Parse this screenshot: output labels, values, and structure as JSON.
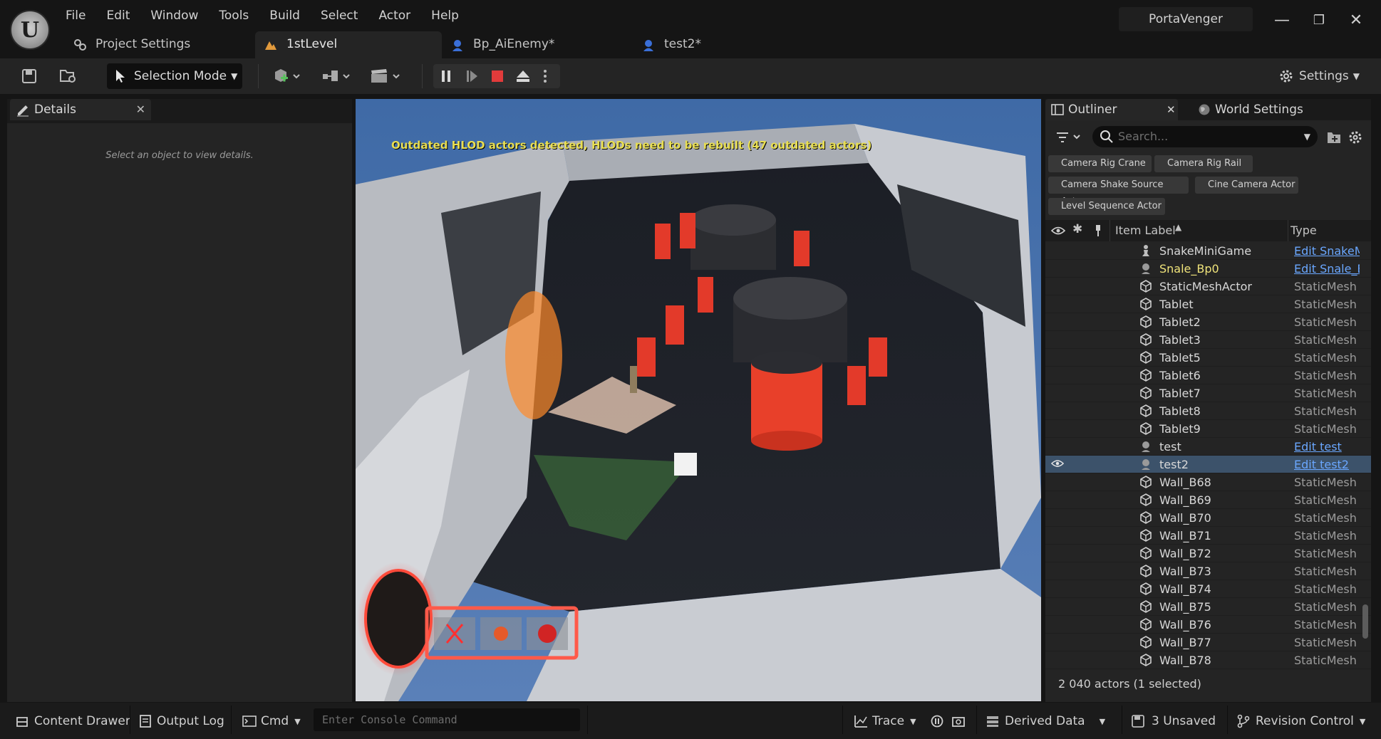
{
  "app": {
    "logo_glyph": "U",
    "menu": [
      "File",
      "Edit",
      "Window",
      "Tools",
      "Build",
      "Select",
      "Actor",
      "Help"
    ],
    "tabs": [
      {
        "label": "Project Settings",
        "icon": "gear-cluster-icon",
        "active": false
      },
      {
        "label": "1stLevel",
        "icon": "level-icon",
        "active": true
      },
      {
        "label": "Bp_AiEnemy*",
        "icon": "blueprint-icon",
        "active": false
      },
      {
        "label": "test2*",
        "icon": "blueprint-icon",
        "active": false
      }
    ],
    "profile": "PortaVenger"
  },
  "toolbar": {
    "mode_label": "Selection Mode",
    "settings_label": "Settings"
  },
  "details": {
    "tab_label": "Details",
    "hint": "Select an object to view details."
  },
  "viewport": {
    "message": "Outdated HLOD actors detected, HLODs need to be rebuilt (47 outdated actors)"
  },
  "outliner": {
    "tab_label": "Outliner",
    "world_settings_label": "World Settings",
    "search_placeholder": "Search...",
    "chips": [
      "Camera Rig Crane",
      "Camera Rig Rail",
      "Camera Shake Source Actor",
      "Cine Camera Actor",
      "Level Sequence Actor"
    ],
    "columns": {
      "label": "Item Label",
      "type": "Type"
    },
    "rows": [
      {
        "label": "SnakeMiniGame",
        "type": "Edit SnakeM",
        "link": true,
        "icon": "pawn-icon",
        "selected": false,
        "highlight": false
      },
      {
        "label": "Snale_Bp0",
        "type": "Edit Snale_B",
        "link": true,
        "icon": "blueprint-actor-icon",
        "selected": false,
        "highlight": true
      },
      {
        "label": "StaticMeshActor",
        "type": "StaticMesh",
        "link": false,
        "icon": "static-mesh-icon",
        "selected": false,
        "highlight": false
      },
      {
        "label": "Tablet",
        "type": "StaticMesh",
        "link": false,
        "icon": "static-mesh-icon",
        "selected": false,
        "highlight": false
      },
      {
        "label": "Tablet2",
        "type": "StaticMesh",
        "link": false,
        "icon": "static-mesh-icon",
        "selected": false,
        "highlight": false
      },
      {
        "label": "Tablet3",
        "type": "StaticMesh",
        "link": false,
        "icon": "static-mesh-icon",
        "selected": false,
        "highlight": false
      },
      {
        "label": "Tablet5",
        "type": "StaticMesh",
        "link": false,
        "icon": "static-mesh-icon",
        "selected": false,
        "highlight": false
      },
      {
        "label": "Tablet6",
        "type": "StaticMesh",
        "link": false,
        "icon": "static-mesh-icon",
        "selected": false,
        "highlight": false
      },
      {
        "label": "Tablet7",
        "type": "StaticMesh",
        "link": false,
        "icon": "static-mesh-icon",
        "selected": false,
        "highlight": false
      },
      {
        "label": "Tablet8",
        "type": "StaticMesh",
        "link": false,
        "icon": "static-mesh-icon",
        "selected": false,
        "highlight": false
      },
      {
        "label": "Tablet9",
        "type": "StaticMesh",
        "link": false,
        "icon": "static-mesh-icon",
        "selected": false,
        "highlight": false
      },
      {
        "label": "test",
        "type": "Edit test",
        "link": true,
        "icon": "blueprint-actor-icon",
        "selected": false,
        "highlight": false
      },
      {
        "label": "test2",
        "type": "Edit test2",
        "link": true,
        "icon": "blueprint-actor-icon",
        "selected": true,
        "highlight": false
      },
      {
        "label": "Wall_B68",
        "type": "StaticMesh",
        "link": false,
        "icon": "static-mesh-icon",
        "selected": false,
        "highlight": false
      },
      {
        "label": "Wall_B69",
        "type": "StaticMesh",
        "link": false,
        "icon": "static-mesh-icon",
        "selected": false,
        "highlight": false
      },
      {
        "label": "Wall_B70",
        "type": "StaticMesh",
        "link": false,
        "icon": "static-mesh-icon",
        "selected": false,
        "highlight": false
      },
      {
        "label": "Wall_B71",
        "type": "StaticMesh",
        "link": false,
        "icon": "static-mesh-icon",
        "selected": false,
        "highlight": false
      },
      {
        "label": "Wall_B72",
        "type": "StaticMesh",
        "link": false,
        "icon": "static-mesh-icon",
        "selected": false,
        "highlight": false
      },
      {
        "label": "Wall_B73",
        "type": "StaticMesh",
        "link": false,
        "icon": "static-mesh-icon",
        "selected": false,
        "highlight": false
      },
      {
        "label": "Wall_B74",
        "type": "StaticMesh",
        "link": false,
        "icon": "static-mesh-icon",
        "selected": false,
        "highlight": false
      },
      {
        "label": "Wall_B75",
        "type": "StaticMesh",
        "link": false,
        "icon": "static-mesh-icon",
        "selected": false,
        "highlight": false
      },
      {
        "label": "Wall_B76",
        "type": "StaticMesh",
        "link": false,
        "icon": "static-mesh-icon",
        "selected": false,
        "highlight": false
      },
      {
        "label": "Wall_B77",
        "type": "StaticMesh",
        "link": false,
        "icon": "static-mesh-icon",
        "selected": false,
        "highlight": false
      },
      {
        "label": "Wall_B78",
        "type": "StaticMesh",
        "link": false,
        "icon": "static-mesh-icon",
        "selected": false,
        "highlight": false
      }
    ],
    "actor_count": "2 040 actors (1 selected)"
  },
  "statusbar": {
    "content_drawer": "Content Drawer",
    "output_log": "Output Log",
    "cmd": "Cmd",
    "console_placeholder": "Enter Console Command",
    "trace": "Trace",
    "derived_data": "Derived Data",
    "unsaved": "3 Unsaved",
    "revision_control": "Revision Control"
  },
  "colors": {
    "accent_selection": "#3c526a",
    "link": "#6aa7ff",
    "hlod_warning": "#e8de52",
    "stop_red": "#e23b3b"
  }
}
